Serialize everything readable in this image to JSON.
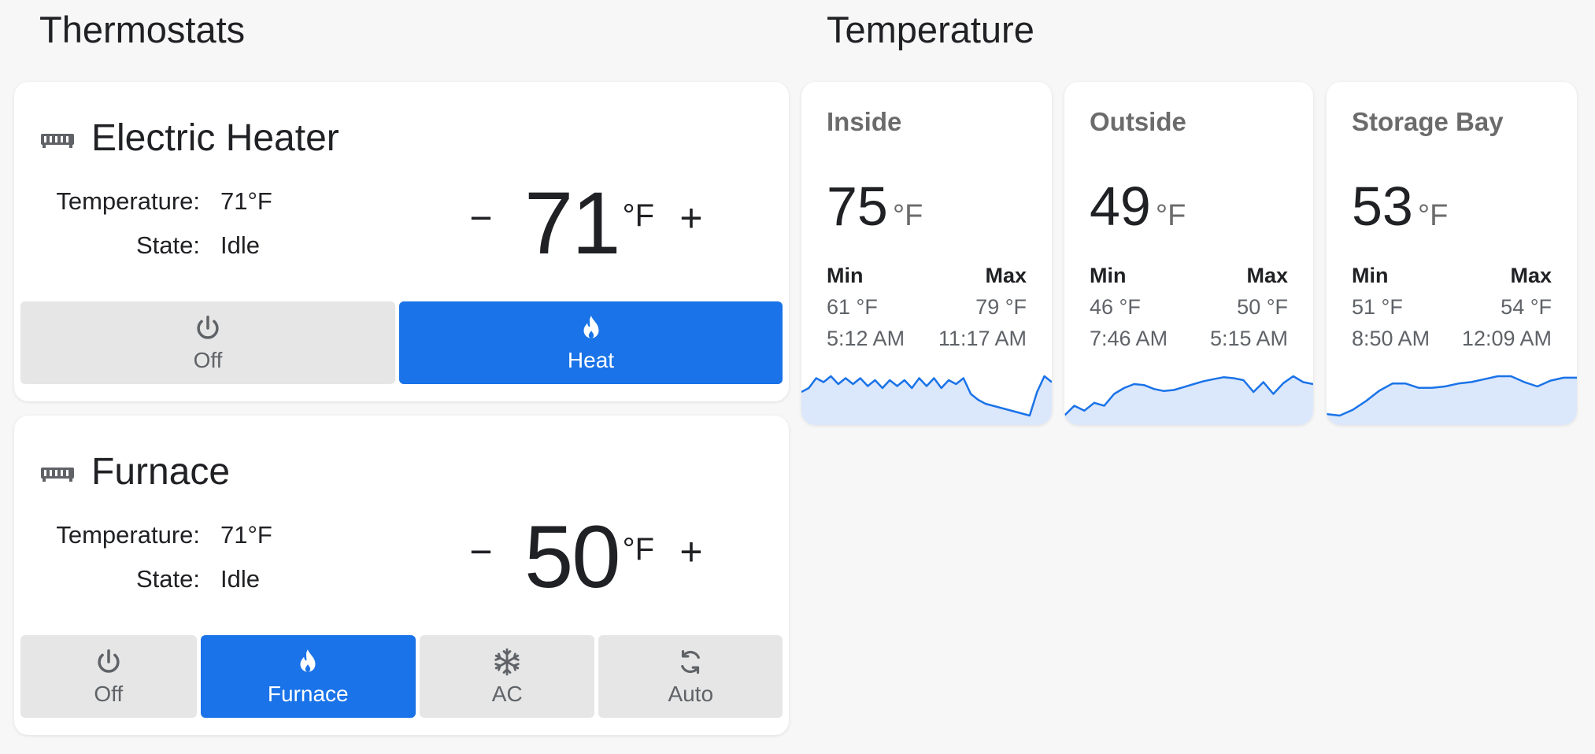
{
  "sections": {
    "thermostats_title": "Thermostats",
    "temperature_title": "Temperature"
  },
  "thermostats": [
    {
      "name": "Electric Heater",
      "icon": "radiator-icon",
      "temperature_label": "Temperature:",
      "temperature_value": "71°F",
      "state_label": "State:",
      "state_value": "Idle",
      "target": "71",
      "unit": "°F",
      "minus": "−",
      "plus": "+",
      "modes": [
        {
          "label": "Off",
          "icon": "power-icon",
          "active": false
        },
        {
          "label": "Heat",
          "icon": "flame-icon",
          "active": true
        }
      ]
    },
    {
      "name": "Furnace",
      "icon": "radiator-icon",
      "temperature_label": "Temperature:",
      "temperature_value": "71°F",
      "state_label": "State:",
      "state_value": "Idle",
      "target": "50",
      "unit": "°F",
      "minus": "−",
      "plus": "+",
      "modes": [
        {
          "label": "Off",
          "icon": "power-icon",
          "active": false
        },
        {
          "label": "Furnace",
          "icon": "flame-icon",
          "active": true
        },
        {
          "label": "AC",
          "icon": "snowflake-icon",
          "active": false
        },
        {
          "label": "Auto",
          "icon": "autorenew-icon",
          "active": false
        }
      ]
    }
  ],
  "sensors": [
    {
      "name": "Inside",
      "value": "75",
      "unit": "°F",
      "min_label": "Min",
      "max_label": "Max",
      "min_value": "61 °F",
      "max_value": "79 °F",
      "min_time": "5:12 AM",
      "max_time": "11:17 AM",
      "sparkline": [
        62,
        64,
        69,
        67,
        70,
        66,
        69,
        66,
        69,
        65,
        68,
        64,
        68,
        65,
        68,
        64,
        69,
        65,
        69,
        64,
        68,
        66,
        69,
        61,
        58,
        56,
        55,
        54,
        53,
        52,
        51,
        50,
        62,
        70,
        67
      ]
    },
    {
      "name": "Outside",
      "value": "49",
      "unit": "°F",
      "min_label": "Min",
      "max_label": "Max",
      "min_value": "46 °F",
      "max_value": "50 °F",
      "min_time": "7:46 AM",
      "max_time": "5:15 AM",
      "sparkline": [
        46,
        47,
        46.5,
        47.3,
        47,
        48.2,
        48.8,
        49.2,
        49.1,
        48.7,
        48.5,
        48.6,
        48.9,
        49.2,
        49.5,
        49.7,
        49.9,
        49.8,
        49.6,
        48.4,
        49.4,
        48.2,
        49.3,
        50,
        49.4,
        49.2
      ]
    },
    {
      "name": "Storage Bay",
      "value": "53",
      "unit": "°F",
      "min_label": "Min",
      "max_label": "Max",
      "min_value": "51 °F",
      "max_value": "54 °F",
      "min_time": "8:50 AM",
      "max_time": "12:09 AM",
      "sparkline": [
        51.3,
        51.2,
        51.6,
        52.2,
        52.9,
        53.4,
        53.4,
        53.1,
        53.1,
        53.2,
        53.4,
        53.5,
        53.7,
        53.9,
        53.9,
        53.5,
        53.2,
        53.6,
        53.8,
        53.8
      ]
    }
  ]
}
